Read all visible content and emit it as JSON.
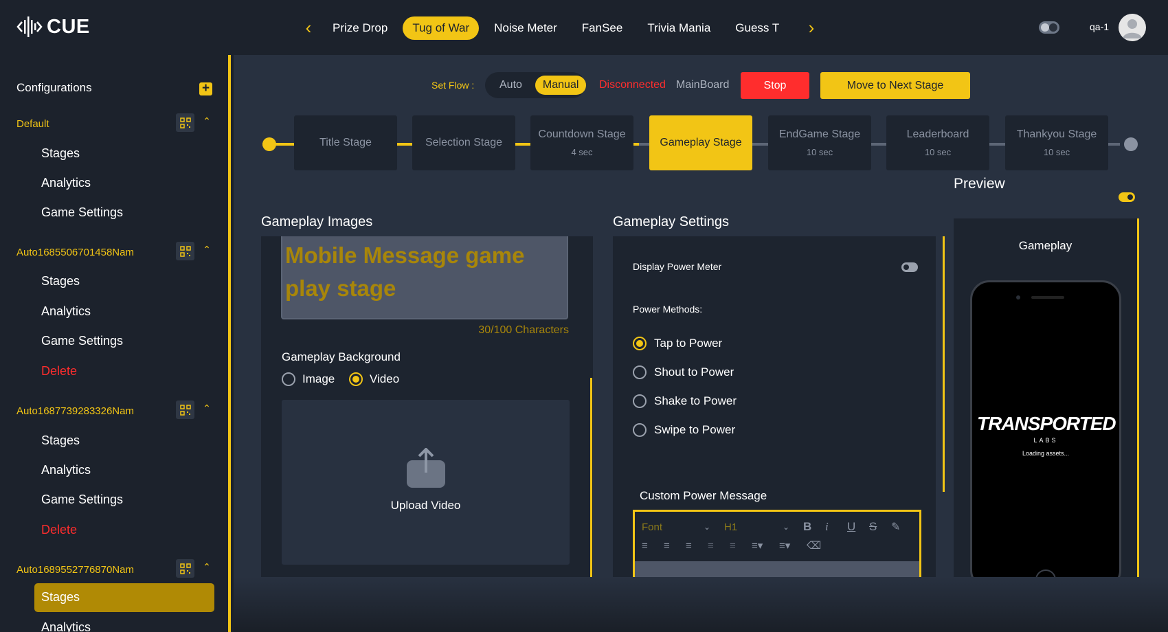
{
  "app": {
    "logo_text": "CUE"
  },
  "header": {
    "game_tabs": [
      "Prize Drop",
      "Tug of War",
      "Noise Meter",
      "FanSee",
      "Trivia Mania",
      "Guess T"
    ],
    "active_tab_index": 1,
    "user_name": "qa-1",
    "icons": {
      "prev": "chevron-left-icon",
      "next": "chevron-right-icon",
      "theme": "theme-toggle-icon",
      "avatar": "user-avatar-icon"
    }
  },
  "sidebar": {
    "title": "Configurations",
    "add_label": "+",
    "groups": [
      {
        "name": "Default",
        "items": [
          "Stages",
          "Analytics",
          "Game Settings"
        ]
      },
      {
        "name": "Auto1685506701458Nam",
        "items": [
          "Stages",
          "Analytics",
          "Game Settings",
          "Delete"
        ]
      },
      {
        "name": "Auto1687739283326Nam",
        "items": [
          "Stages",
          "Analytics",
          "Game Settings",
          "Delete"
        ]
      },
      {
        "name": "Auto1689552776870Nam",
        "items": [
          "Stages",
          "Analytics"
        ],
        "active_item": "Stages"
      }
    ]
  },
  "flow": {
    "label": "Set Flow :",
    "options": [
      "Auto",
      "Manual"
    ],
    "selected": "Manual",
    "status": "Disconnected",
    "board": "MainBoard",
    "stop_label": "Stop",
    "next_label": "Move to Next Stage"
  },
  "stages": [
    {
      "name": "Title Stage",
      "duration": ""
    },
    {
      "name": "Selection Stage",
      "duration": ""
    },
    {
      "name": "Countdown Stage",
      "duration": "4 sec"
    },
    {
      "name": "Gameplay Stage",
      "duration": "",
      "active": true
    },
    {
      "name": "EndGame Stage",
      "duration": "10 sec"
    },
    {
      "name": "Leaderboard",
      "duration": "10 sec"
    },
    {
      "name": "Thankyou Stage",
      "duration": "10 sec"
    }
  ],
  "gameplay_images": {
    "title": "Gameplay Images",
    "message": "Mobile Message game play stage",
    "char_count": "30/100 Characters",
    "background_label": "Gameplay Background",
    "background_options": [
      "Image",
      "Video"
    ],
    "background_selected": "Video",
    "upload_label": "Upload Video"
  },
  "gameplay_settings": {
    "title": "Gameplay Settings",
    "display_power_meter_label": "Display Power Meter",
    "power_meter_on": false,
    "power_methods_label": "Power Methods:",
    "power_methods": [
      "Tap to Power",
      "Shout to Power",
      "Shake to Power",
      "Swipe to Power"
    ],
    "power_method_selected": "Tap to Power",
    "custom_message_label": "Custom Power Message",
    "editor": {
      "font_placeholder": "Font",
      "heading_value": "H1"
    }
  },
  "preview": {
    "title": "Preview",
    "enabled": true,
    "screen_label": "Gameplay",
    "brand": "TRANSPORTED",
    "brand_sub": "LABS",
    "loading": "Loading assets..."
  }
}
